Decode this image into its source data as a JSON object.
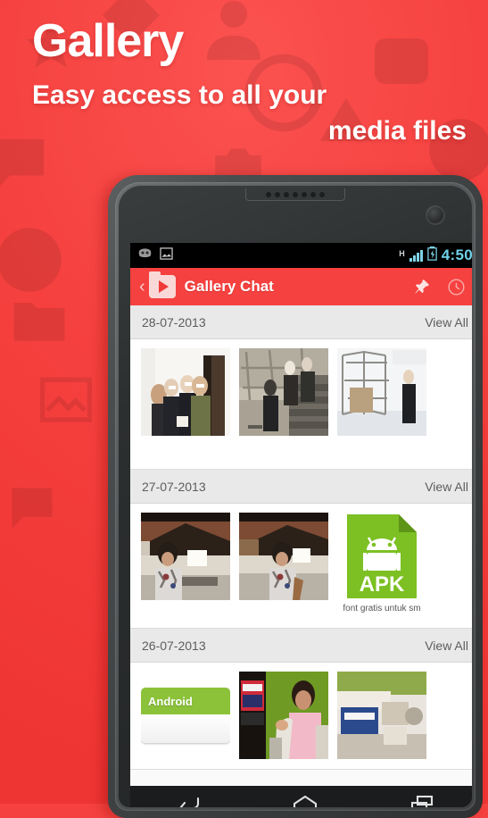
{
  "promo": {
    "title": "Gallery",
    "subtitle_line1": "Easy access to all your",
    "subtitle_line2": "media files",
    "background_color": "#f5413f",
    "text_color": "#ffffff"
  },
  "phone": {
    "status_bar": {
      "background_color": "#000000",
      "time": "4:50",
      "time_color": "#6fd2e8",
      "network_type": "H",
      "signal_bars": 4,
      "battery_state": "charging",
      "notification_icons": [
        "android-robot-icon",
        "photo-icon"
      ]
    },
    "action_bar": {
      "background_color": "#f5413f",
      "back_label": "‹",
      "app_icon": "gallery-folder-play-icon",
      "title": "Gallery Chat",
      "actions": [
        "pin-icon",
        "clock-icon"
      ]
    },
    "nav_bar": {
      "background_color": "#1b1c1d",
      "buttons": [
        "back-icon",
        "home-icon",
        "recent-apps-icon"
      ]
    }
  },
  "list": {
    "view_all_label": "View All",
    "sections": [
      {
        "date": "28-07-2013",
        "items": [
          {
            "caption": "",
            "art": "ph1"
          },
          {
            "caption": "",
            "art": "ph2"
          },
          {
            "caption": "",
            "art": "ph3"
          }
        ]
      },
      {
        "date": "27-07-2013",
        "items": [
          {
            "caption": "",
            "art": "ph4"
          },
          {
            "caption": "",
            "art": "ph5"
          },
          {
            "caption": "font gratis untuk sm",
            "art": "apk"
          }
        ]
      },
      {
        "date": "26-07-2013",
        "items": [
          {
            "caption": "",
            "art": "android-card"
          },
          {
            "caption": "",
            "art": "ph6"
          },
          {
            "caption": "",
            "art": "ph7"
          }
        ]
      }
    ]
  },
  "apk_icon": {
    "label": "APK",
    "color": "#7cc023"
  }
}
